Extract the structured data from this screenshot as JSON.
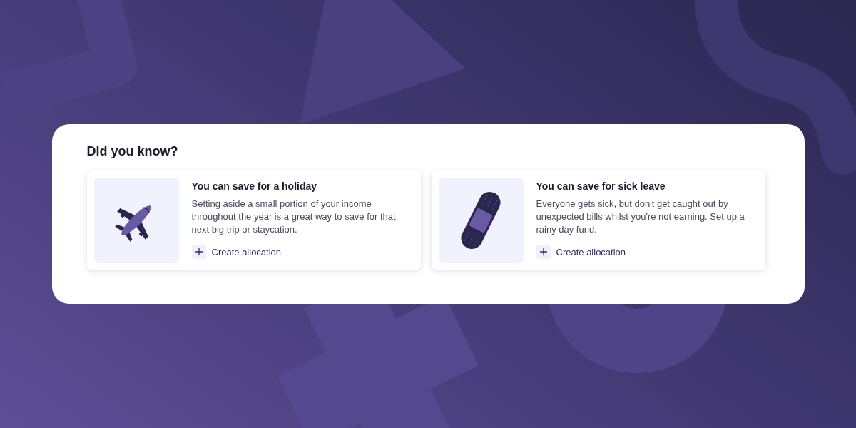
{
  "panel": {
    "title": "Did you know?"
  },
  "cards": [
    {
      "kind": "plane",
      "heading": "You can save for a holiday",
      "body": "Setting aside a small portion of your income throughout the year is a great way to save for that next big trip or staycation.",
      "action": "Create allocation"
    },
    {
      "kind": "plaster",
      "heading": "You can save for sick leave",
      "body": "Everyone gets sick, but don't get caught out by unexpected bills whilst you're not earning. Set up a rainy day fund.",
      "action": "Create allocation"
    }
  ]
}
